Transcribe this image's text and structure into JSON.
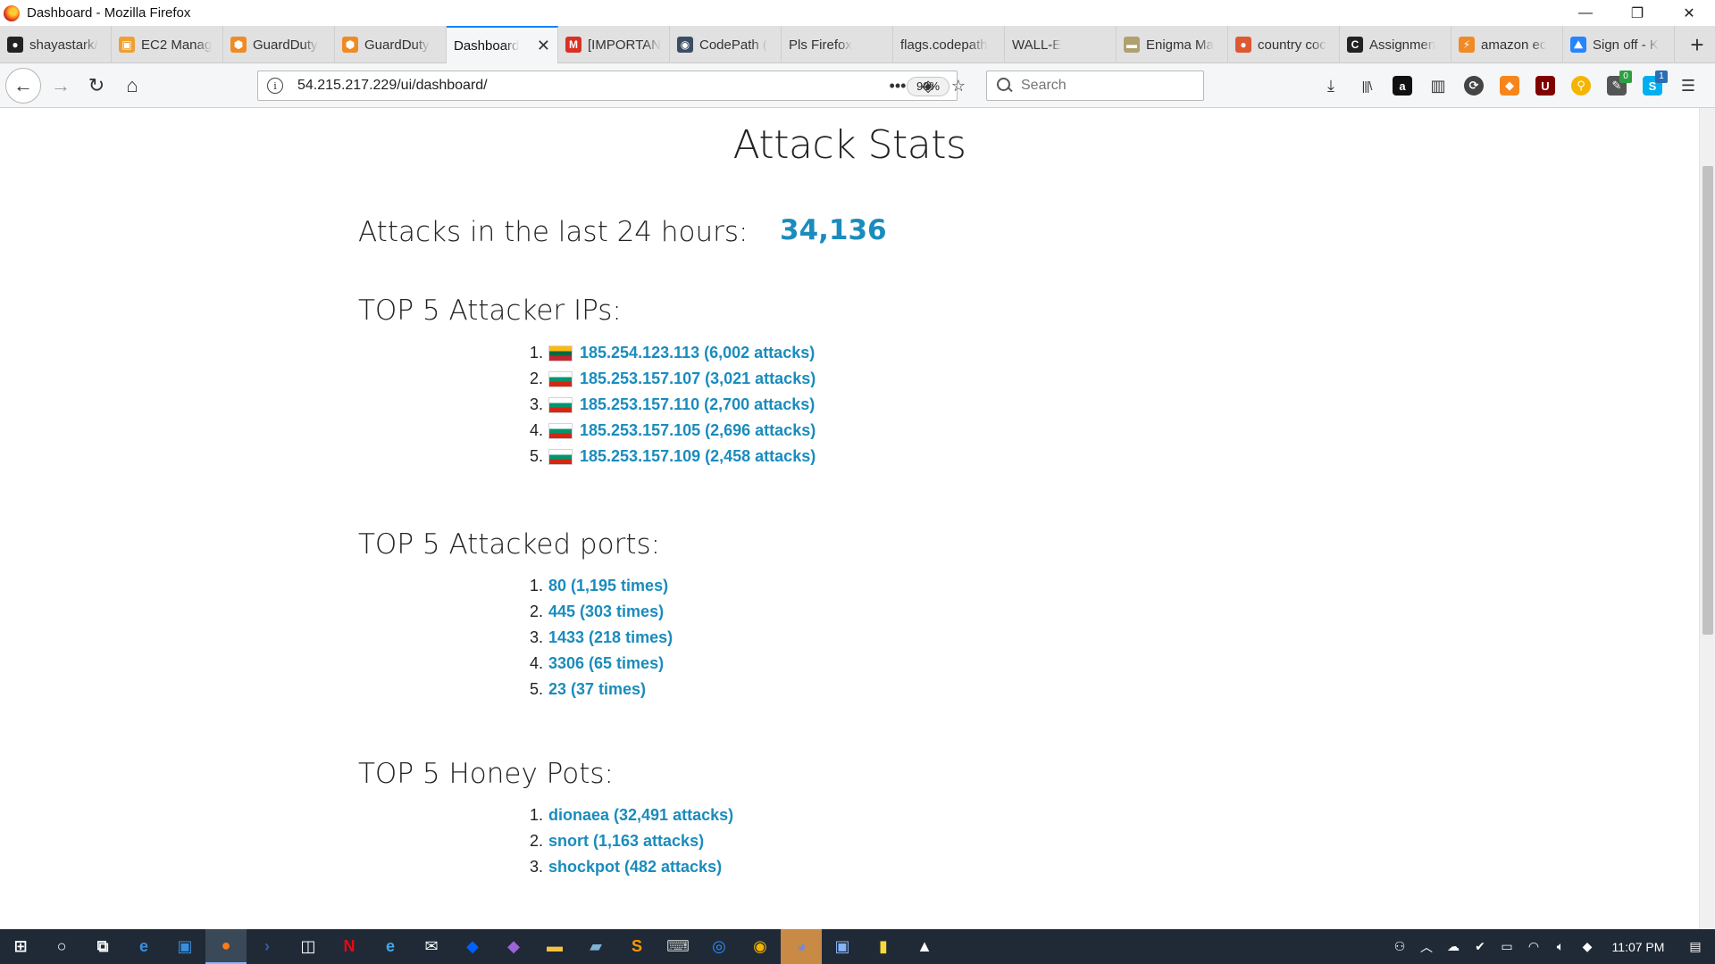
{
  "window": {
    "title": "Dashboard - Mozilla Firefox",
    "minimize": "—",
    "restore": "❐",
    "close": "✕"
  },
  "tabs": [
    {
      "label": "shayastark/",
      "icon": "github-icon",
      "icon_char": "●",
      "icon_color": "#222222"
    },
    {
      "label": "EC2 Manag",
      "icon": "aws-cube-icon",
      "icon_char": "▣",
      "icon_color": "#f0a030"
    },
    {
      "label": "GuardDuty",
      "icon": "aws-guardduty-icon",
      "icon_char": "⬢",
      "icon_color": "#f08a24"
    },
    {
      "label": "GuardDuty",
      "icon": "aws-guardduty-icon",
      "icon_char": "⬢",
      "icon_color": "#f08a24"
    },
    {
      "label": "Dashboard",
      "icon": "",
      "icon_char": "",
      "icon_color": "",
      "active": true
    },
    {
      "label": "[IMPORTAN",
      "icon": "gmail-icon",
      "icon_char": "M",
      "icon_color": "#d93025"
    },
    {
      "label": "CodePath (",
      "icon": "globe-icon",
      "icon_char": "◉",
      "icon_color": "#3b4d61"
    },
    {
      "label": "Pls Firefox",
      "icon": "",
      "icon_char": "",
      "icon_color": ""
    },
    {
      "label": "flags.codepath",
      "icon": "",
      "icon_char": "",
      "icon_color": ""
    },
    {
      "label": "WALL-E",
      "icon": "",
      "icon_char": "",
      "icon_color": ""
    },
    {
      "label": "Enigma Ma",
      "icon": "enigma-icon",
      "icon_char": "▬",
      "icon_color": "#b0a070"
    },
    {
      "label": "country coc",
      "icon": "duckduckgo-icon",
      "icon_char": "●",
      "icon_color": "#de5833"
    },
    {
      "label": "Assignmen",
      "icon": "codepath-c-icon",
      "icon_char": "C",
      "icon_color": "#222222"
    },
    {
      "label": "amazon ec",
      "icon": "aws-icon",
      "icon_char": "⚡",
      "icon_color": "#f08a24"
    },
    {
      "label": "Sign off - K",
      "icon": "atlassian-icon",
      "icon_char": "⛰",
      "icon_color": "#2684ff"
    }
  ],
  "tab_close": "✕",
  "new_tab": "+",
  "navbar": {
    "back": "←",
    "forward": "→",
    "reload": "↻",
    "home": "⌂",
    "url": "54.215.217.229/ui/dashboard/",
    "zoom": "90%",
    "page_actions": "•••",
    "pocket": "◈",
    "bookmark": "☆",
    "search_placeholder": "Search"
  },
  "toolbar": {
    "download": "⤓",
    "library": "|||\\",
    "amazon_assistant": "a",
    "reader_view": "▥",
    "ext_badge_1": "0",
    "ext_badge_2": "1"
  },
  "page": {
    "title": "Attack Stats",
    "attacks_24h_label": "Attacks in the last 24 hours:",
    "attacks_24h_value": "34,136",
    "top_ips_title": "TOP 5 Attacker IPs:",
    "top_ips": [
      {
        "rank": "1.",
        "text": "185.254.123.113 (6,002 attacks)",
        "flag": "lithuania"
      },
      {
        "rank": "2.",
        "text": "185.253.157.107 (3,021 attacks)",
        "flag": "bulgaria"
      },
      {
        "rank": "3.",
        "text": "185.253.157.110 (2,700 attacks)",
        "flag": "bulgaria"
      },
      {
        "rank": "4.",
        "text": "185.253.157.105 (2,696 attacks)",
        "flag": "bulgaria"
      },
      {
        "rank": "5.",
        "text": "185.253.157.109 (2,458 attacks)",
        "flag": "bulgaria"
      }
    ],
    "top_ports_title": "TOP 5 Attacked ports:",
    "top_ports": [
      {
        "rank": "1.",
        "text": "80 (1,195 times)"
      },
      {
        "rank": "2.",
        "text": "445 (303 times)"
      },
      {
        "rank": "3.",
        "text": "1433 (218 times)"
      },
      {
        "rank": "4.",
        "text": "3306 (65 times)"
      },
      {
        "rank": "5.",
        "text": "23 (37 times)"
      }
    ],
    "top_honeypots_title": "TOP 5 Honey Pots:",
    "top_honeypots": [
      {
        "rank": "1.",
        "text": "dionaea (32,491 attacks)"
      },
      {
        "rank": "2.",
        "text": "snort (1,163 attacks)"
      },
      {
        "rank": "3.",
        "text": "shockpot (482 attacks)"
      }
    ],
    "link_color": "#1a8cbd"
  },
  "taskbar": {
    "clock": "11:07 PM",
    "apps": [
      {
        "name": "windows-start-icon",
        "char": "⊞",
        "color": "#ffffff"
      },
      {
        "name": "cortana-icon",
        "char": "○",
        "color": "#ffffff"
      },
      {
        "name": "task-view-icon",
        "char": "⧉",
        "color": "#ffffff"
      },
      {
        "name": "edge-icon",
        "char": "e",
        "color": "#3b8ede"
      },
      {
        "name": "store-app-icon",
        "char": "▣",
        "color": "#3b8ede"
      },
      {
        "name": "firefox-icon",
        "char": "●",
        "color": "#ff7a1a",
        "active": true
      },
      {
        "name": "powershell-icon",
        "char": "›",
        "color": "#3b5ba5"
      },
      {
        "name": "store-icon",
        "char": "◫",
        "color": "#ffffff"
      },
      {
        "name": "netflix-icon",
        "char": "N",
        "color": "#e50914"
      },
      {
        "name": "ie-icon",
        "char": "e",
        "color": "#43a6e8"
      },
      {
        "name": "mail-icon",
        "char": "✉",
        "color": "#ffffff"
      },
      {
        "name": "dropbox-icon",
        "char": "◆",
        "color": "#0061ff"
      },
      {
        "name": "git-icon",
        "char": "◆",
        "color": "#9c64d6"
      },
      {
        "name": "file-explorer-icon",
        "char": "▬",
        "color": "#f5c242"
      },
      {
        "name": "notes-icon",
        "char": "▰",
        "color": "#7fb3d5"
      },
      {
        "name": "sublime-icon",
        "char": "S",
        "color": "#ff9800"
      },
      {
        "name": "keyboard-icon",
        "char": "⌨",
        "color": "#bbbbbb"
      },
      {
        "name": "zoom-icon",
        "char": "◎",
        "color": "#2d8cff"
      },
      {
        "name": "chrome-icon",
        "char": "◉",
        "color": "#f5b400"
      },
      {
        "name": "discord-icon",
        "char": "◕",
        "color": "#7289da",
        "highlight": true
      },
      {
        "name": "window-app-icon",
        "char": "▣",
        "color": "#8ab4f8"
      },
      {
        "name": "sticky-notes-icon",
        "char": "▮",
        "color": "#f7d93b"
      },
      {
        "name": "photos-icon",
        "char": "▲",
        "color": "#ffffff"
      }
    ],
    "tray": [
      {
        "name": "people-icon",
        "char": "⚇"
      },
      {
        "name": "tray-chevron-icon",
        "char": "︿"
      },
      {
        "name": "onedrive-icon",
        "char": "☁"
      },
      {
        "name": "norton-icon",
        "char": "✔"
      },
      {
        "name": "battery-icon",
        "char": "▭"
      },
      {
        "name": "wifi-icon",
        "char": "◠"
      },
      {
        "name": "volume-icon",
        "char": "🔈︎"
      },
      {
        "name": "dropbox-tray-icon",
        "char": "◆"
      }
    ],
    "notifications": "▤"
  }
}
